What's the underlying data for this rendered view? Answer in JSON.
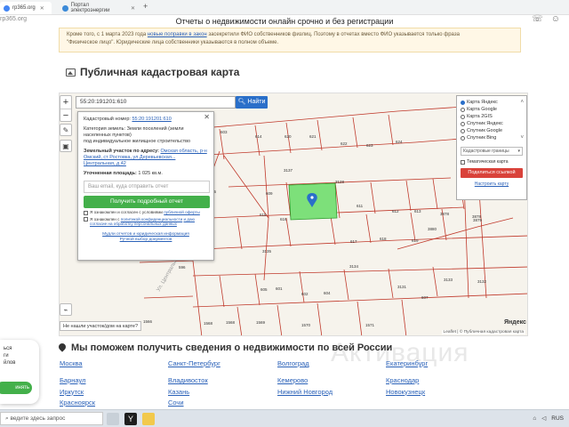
{
  "browser": {
    "tabs": [
      {
        "label": "rp365.org"
      },
      {
        "label": "Портал электроэнергии"
      }
    ],
    "url_fragment": "rp365.org"
  },
  "header": {
    "title": "Отчеты о недвижимости онлайн срочно и без регистрации"
  },
  "notice": {
    "line1_before": "Кроме того, с 1 марта 2023 года",
    "line1_link": "новые поправки в закон",
    "line1_after": "засекретили ФИО собственников физлиц. Поэтому в отчетах вместо ФИО указывается только фраза",
    "line2": "\"Физическое лицо\". Юридические лица собственники указываются в полном объеме."
  },
  "map_section": {
    "title": "Публичная кадастровая карта",
    "search_value": "55:20:191201:610",
    "find_label": "Найти",
    "not_found": "Не нашли участок/дом на карте?",
    "yandex": "Яндекс",
    "attribution": "Leaflet | © Публичная кадастровая карта"
  },
  "popup": {
    "cad_label": "Кадастровый номер:",
    "cad_value": "55:20:191201:610",
    "category_label": "Категория земель:",
    "category_value": "Земли поселений (земли населенных пунктов)",
    "use_value": "под индивидуальное жилищное строительство",
    "address_label": "Земельный участок по адресу:",
    "address_value": "Омская область, р-н Омский, ст Ростовка, ул Деревьевская...",
    "address_line2": "Центральная, д 42",
    "area_label": "Уточненная площадь:",
    "area_value": "1 025 кв.м.",
    "email_placeholder": "Ваш email, куда отправить отчет",
    "get_report": "Получить подробный отчет",
    "consent1_a": "Я ознакомлен и согласен с условиями",
    "consent1_b": "публичной оферты",
    "consent2_a": "Я ознакомлен с",
    "consent2_b": "политикой конфиденциальности",
    "consent2_c": "и даю согласие на обработку персональных данных",
    "foot1": "Мудли отчетов и юридическая информация",
    "foot2": "Ручной выбор документов"
  },
  "layers": {
    "options": [
      "Карта Яндекс",
      "Карта Google",
      "Карта 2GIS",
      "Спутник Яндекс",
      "Спутник Google",
      "Спутник Bing"
    ],
    "selected": "Карта Яндекс",
    "borders_select": "Кадастровые границы",
    "thematic": "Тематическая карта",
    "share": "Поделиться ссылкой",
    "setup": "Настроить карту"
  },
  "parcels": [
    "603",
    "614",
    "620",
    "621",
    "622",
    "623",
    "624",
    "3137",
    "3128",
    "3136",
    "609",
    "611",
    "612",
    "613",
    "3878",
    "3879",
    "615",
    "616",
    "618",
    "619",
    "617",
    "3880",
    "3878",
    "3135",
    "3135",
    "3134",
    "3133",
    "3132",
    "605",
    "601",
    "602",
    "604",
    "3131",
    "596",
    "607",
    "1566",
    "1568",
    "1568",
    "1569",
    "1570",
    "1571"
  ],
  "help": {
    "title": "Мы поможем получить сведения о недвижимости по всей России",
    "watermark": "Активация",
    "cities_col1": [
      "Москва",
      "Барнаул",
      "Иркутск",
      "Красноярск"
    ],
    "cities_col2": [
      "Санкт-Петербург",
      "Владивосток",
      "Казань",
      "Сочи"
    ],
    "cities_col3": [
      "Волгоград",
      "Кемерово",
      "Нижний Новгород"
    ],
    "cities_col4": [
      "Екатеринбург",
      "Краснодар",
      "Новокузнецк"
    ]
  },
  "cookie": {
    "line1": "ься",
    "line2": "ги",
    "line3": "йлов",
    "accept": "инять"
  },
  "taskbar": {
    "search": "ведите здесь запрос",
    "tray": "RUS"
  },
  "colors": {
    "accent": "#2a6fc9",
    "green": "#43b04a",
    "selected_parcel": "#7de07a",
    "parcel_line": "#c0392b",
    "share": "#d9423a"
  }
}
